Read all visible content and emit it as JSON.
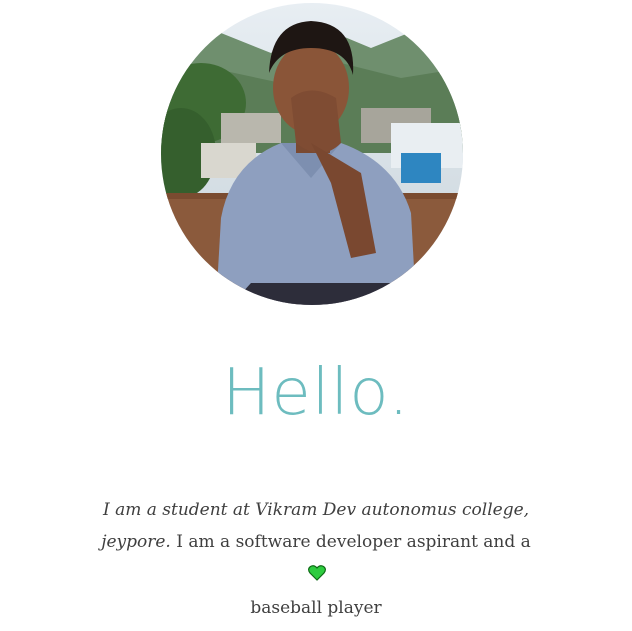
{
  "profile": {
    "avatar_icon": "profile-photo",
    "greeting": "Hello.",
    "greeting_color": "#6dbcbf",
    "bio_italic": "I am a student at Vikram Dev autonomus college, jeypore.",
    "bio_text": " I am a software developer aspirant and a",
    "bio_icon": "green-heart-icon",
    "bio_icon_color": "#2ecc40",
    "bio_text_end": "baseball player"
  }
}
